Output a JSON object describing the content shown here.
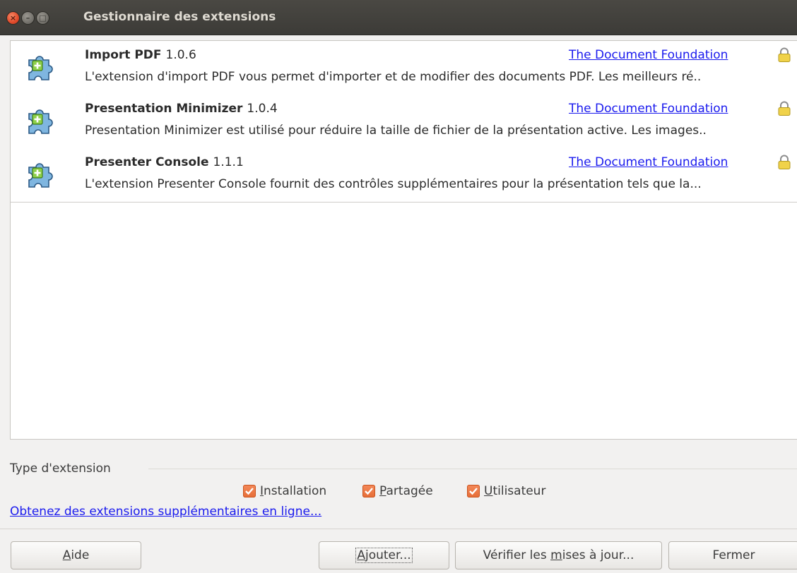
{
  "window": {
    "title": "Gestionnaire des extensions",
    "close_glyph": "×",
    "minimize_glyph": "–",
    "maximize_glyph": "□"
  },
  "extensions": [
    {
      "name": "Import PDF",
      "version": "1.0.6",
      "publisher": "The Document Foundation",
      "description": "L'extension d'import PDF vous permet d'importer et de modifier des documents PDF. Les meilleurs ré..",
      "icon": "puzzle-extension-icon",
      "locked": true
    },
    {
      "name": "Presentation Minimizer",
      "version": "1.0.4",
      "publisher": "The Document Foundation",
      "description": "Presentation Minimizer est utilisé pour réduire la taille de fichier de la présentation active. Les images..",
      "icon": "puzzle-extension-icon",
      "locked": true
    },
    {
      "name": "Presenter Console",
      "version": "1.1.1",
      "publisher": "The Document Foundation",
      "description": "L'extension Presenter Console fournit des contrôles supplémentaires pour la présentation tels que la...",
      "icon": "puzzle-extension-icon",
      "locked": true
    }
  ],
  "filter": {
    "label": "Type d'extension",
    "options": [
      {
        "key": "I",
        "rest": "nstallation",
        "checked": true
      },
      {
        "key": "P",
        "rest": "artagée",
        "checked": true
      },
      {
        "key": "U",
        "rest": "tilisateur",
        "checked": true
      }
    ]
  },
  "more_link": "Obtenez des extensions supplémentaires en ligne...",
  "buttons": {
    "help": {
      "key": "A",
      "rest": "ide"
    },
    "add": {
      "key": "A",
      "rest": "jouter..."
    },
    "update": {
      "pre": "Vérifier les ",
      "key": "m",
      "rest": "ises à jour..."
    },
    "close": "Fermer"
  },
  "colors": {
    "titlebar": "#3c3b37",
    "link": "#1a1aee",
    "checkbox_accent": "#e66d36",
    "close_button": "#e0492a"
  }
}
